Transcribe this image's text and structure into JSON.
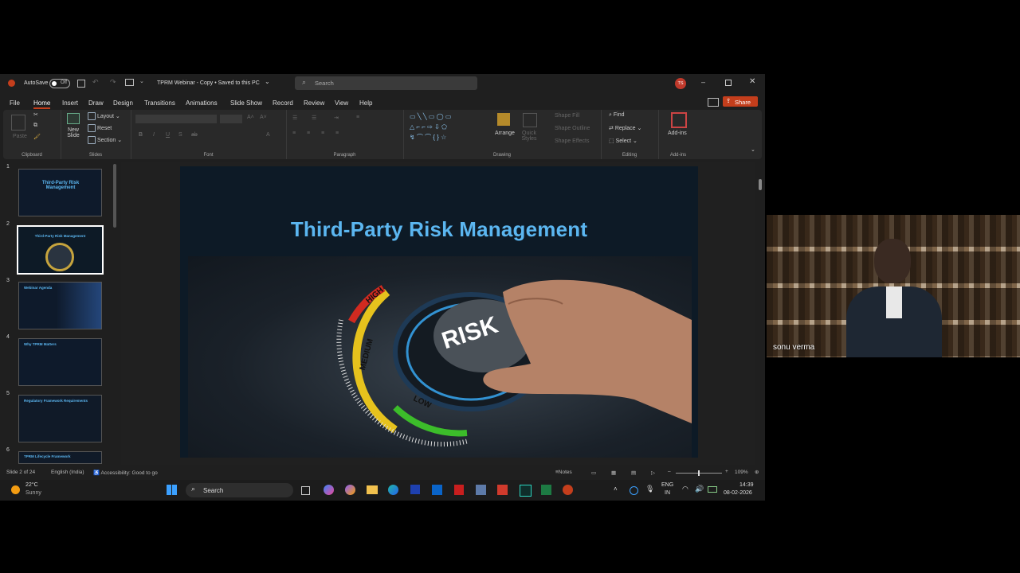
{
  "window": {
    "autosave_label": "AutoSave",
    "autosave_state": "Off",
    "doc_title": "TPRM Webinar - Copy • Saved to this PC",
    "search_placeholder": "Search",
    "user_initials": "TS"
  },
  "menu": {
    "items": [
      "File",
      "Home",
      "Insert",
      "Draw",
      "Design",
      "Transitions",
      "Animations",
      "Slide Show",
      "Record",
      "Review",
      "View",
      "Help"
    ],
    "active": "Home",
    "share_label": "Share"
  },
  "ribbon": {
    "clipboard": {
      "paste": "Paste",
      "label": "Clipboard"
    },
    "slides": {
      "new_slide": "New Slide",
      "layout": "Layout",
      "reset": "Reset",
      "section": "Section",
      "label": "Slides"
    },
    "font": {
      "label": "Font"
    },
    "paragraph": {
      "label": "Paragraph"
    },
    "drawing": {
      "arrange": "Arrange",
      "quick_styles": "Quick Styles",
      "shape_fill": "Shape Fill",
      "shape_outline": "Shape Outline",
      "shape_effects": "Shape Effects",
      "label": "Drawing"
    },
    "editing": {
      "find": "Find",
      "replace": "Replace",
      "select": "Select",
      "label": "Editing"
    },
    "addins": {
      "addins": "Add-ins",
      "label": "Add-ins"
    }
  },
  "thumbnails": [
    {
      "num": "1",
      "title": "Third-Party Risk Management"
    },
    {
      "num": "2",
      "title": "Third-Party Risk Management"
    },
    {
      "num": "3",
      "title": "Webinar Agenda"
    },
    {
      "num": "4",
      "title": "Why TPRM Matters"
    },
    {
      "num": "5",
      "title": "Regulatory Framework Requirements"
    },
    {
      "num": "6",
      "title": "TPRM Lifecycle Framework"
    }
  ],
  "slide": {
    "title": "Third-Party Risk Management",
    "knob_text": "RISK",
    "dial_high": "HIGH",
    "dial_medium": "MEDIUM",
    "dial_low": "LOW"
  },
  "status": {
    "slide_count": "Slide 2 of 24",
    "language": "English (India)",
    "accessibility": "Accessibility: Good to go",
    "notes": "Notes",
    "zoom": "109%"
  },
  "taskbar": {
    "temp": "22°C",
    "weather": "Sunny",
    "search": "Search",
    "lang1": "ENG",
    "lang2": "IN",
    "time": "14:39",
    "date": "08-02-2026"
  },
  "video": {
    "participant": "sonu verma"
  },
  "colors": {
    "accent": "#c43e1c",
    "title_blue": "#5bb6f0",
    "active_tab": "#ffffff"
  }
}
